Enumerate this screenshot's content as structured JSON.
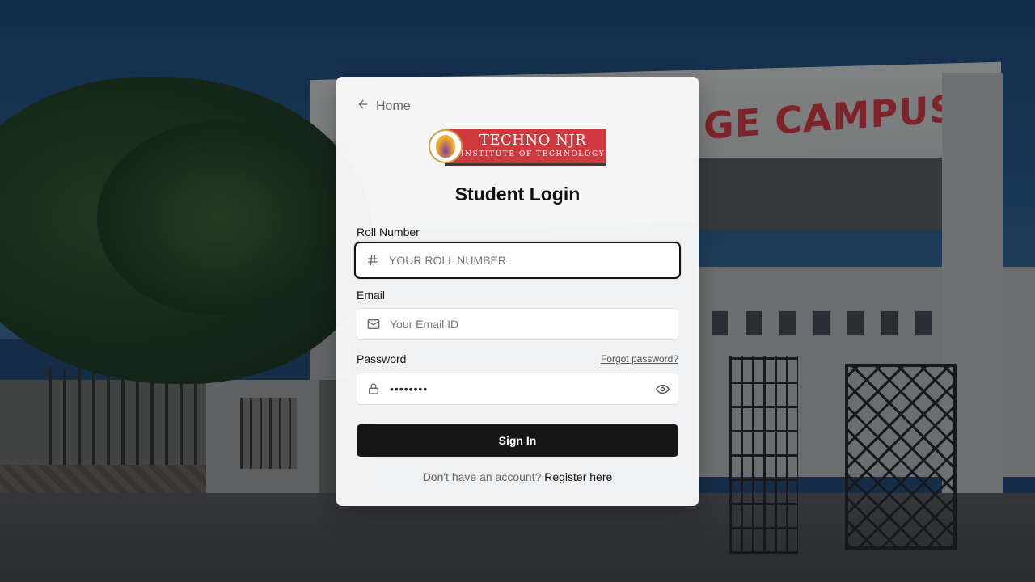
{
  "background": {
    "arch_sign_text": "GE CAMPUS"
  },
  "nav": {
    "home_label": "Home"
  },
  "logo": {
    "title": "TECHNO NJR",
    "subtitle": "INSTITUTE OF TECHNOLOGY"
  },
  "page": {
    "title": "Student Login"
  },
  "form": {
    "roll_number": {
      "label": "Roll Number",
      "placeholder": "YOUR ROLL NUMBER",
      "value": "",
      "icon": "hash-icon"
    },
    "email": {
      "label": "Email",
      "placeholder": "Your Email ID",
      "value": "",
      "icon": "mail-icon"
    },
    "password": {
      "label": "Password",
      "value": "••••••••",
      "icon": "lock-icon",
      "toggle_icon": "eye-icon",
      "forgot_label": "Forgot password?"
    },
    "submit_label": "Sign In"
  },
  "footer": {
    "prompt": "Don't have an account?",
    "register_label": "Register here"
  },
  "colors": {
    "button_bg": "#161616",
    "logo_red": "#cf3a40",
    "sign_red": "#b52c2f"
  }
}
